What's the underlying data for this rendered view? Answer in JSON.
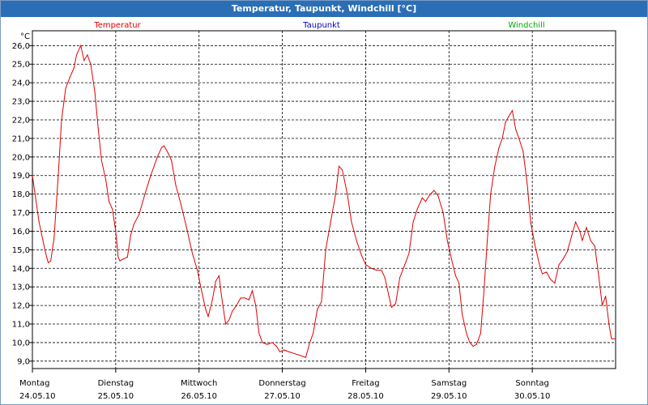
{
  "window": {
    "title": "Temperatur, Taupunkt, Windchill [°C]"
  },
  "chart_data": {
    "type": "line",
    "title": "Temperatur, Taupunkt, Windchill [°C]",
    "ylabel": "°C",
    "ylim": [
      8.6,
      26.8
    ],
    "yticks": [
      "26,0",
      "25,0",
      "24,0",
      "23,0",
      "22,0",
      "21,0",
      "20,0",
      "19,0",
      "18,0",
      "17,0",
      "16,0",
      "15,0",
      "14,0",
      "13,0",
      "12,0",
      "11,0",
      "10,0",
      "9,0"
    ],
    "xlim": [
      0,
      7
    ],
    "x_unit": "days since start of Montag 24.05.10",
    "days": [
      {
        "weekday": "Montag",
        "date": "24.05.10"
      },
      {
        "weekday": "Dienstag",
        "date": "25.05.10"
      },
      {
        "weekday": "Mittwoch",
        "date": "26.05.10"
      },
      {
        "weekday": "Donnerstag",
        "date": "27.05.10"
      },
      {
        "weekday": "Freitag",
        "date": "28.05.10"
      },
      {
        "weekday": "Samstag",
        "date": "29.05.10"
      },
      {
        "weekday": "Sonntag",
        "date": "30.05.10"
      }
    ],
    "legend_placement": "top",
    "grid": true,
    "series": [
      {
        "name": "Temperatur",
        "color": "#e00000",
        "points": [
          [
            0.0,
            19.0
          ],
          [
            0.08,
            16.5
          ],
          [
            0.15,
            15.0
          ],
          [
            0.19,
            14.3
          ],
          [
            0.22,
            14.4
          ],
          [
            0.26,
            15.6
          ],
          [
            0.31,
            19.0
          ],
          [
            0.35,
            22.0
          ],
          [
            0.4,
            23.7
          ],
          [
            0.45,
            24.3
          ],
          [
            0.5,
            24.8
          ],
          [
            0.53,
            25.5
          ],
          [
            0.58,
            26.0
          ],
          [
            0.62,
            25.2
          ],
          [
            0.66,
            25.5
          ],
          [
            0.7,
            25.0
          ],
          [
            0.75,
            23.5
          ],
          [
            0.79,
            21.5
          ],
          [
            0.83,
            19.8
          ],
          [
            0.88,
            18.8
          ],
          [
            0.92,
            17.6
          ],
          [
            0.96,
            17.2
          ],
          [
            1.0,
            16.0
          ],
          [
            1.03,
            14.6
          ],
          [
            1.05,
            14.4
          ],
          [
            1.09,
            14.5
          ],
          [
            1.14,
            14.6
          ],
          [
            1.18,
            15.8
          ],
          [
            1.22,
            16.4
          ],
          [
            1.28,
            16.9
          ],
          [
            1.35,
            18.0
          ],
          [
            1.42,
            19.0
          ],
          [
            1.5,
            20.0
          ],
          [
            1.55,
            20.5
          ],
          [
            1.58,
            20.6
          ],
          [
            1.63,
            20.2
          ],
          [
            1.67,
            19.8
          ],
          [
            1.72,
            18.5
          ],
          [
            1.78,
            17.5
          ],
          [
            1.85,
            16.2
          ],
          [
            1.92,
            14.8
          ],
          [
            1.98,
            13.9
          ],
          [
            2.03,
            12.8
          ],
          [
            2.08,
            11.8
          ],
          [
            2.11,
            11.4
          ],
          [
            2.16,
            12.3
          ],
          [
            2.2,
            13.3
          ],
          [
            2.24,
            13.6
          ],
          [
            2.27,
            12.5
          ],
          [
            2.32,
            11.0
          ],
          [
            2.36,
            11.2
          ],
          [
            2.4,
            11.7
          ],
          [
            2.45,
            12.0
          ],
          [
            2.5,
            12.4
          ],
          [
            2.55,
            12.4
          ],
          [
            2.6,
            12.3
          ],
          [
            2.64,
            12.8
          ],
          [
            2.68,
            12.0
          ],
          [
            2.72,
            10.5
          ],
          [
            2.76,
            10.0
          ],
          [
            2.82,
            9.9
          ],
          [
            2.88,
            10.0
          ],
          [
            2.93,
            9.8
          ],
          [
            2.97,
            9.5
          ],
          [
            3.02,
            9.6
          ],
          [
            3.08,
            9.5
          ],
          [
            3.15,
            9.4
          ],
          [
            3.22,
            9.3
          ],
          [
            3.28,
            9.2
          ],
          [
            3.33,
            10.0
          ],
          [
            3.37,
            10.5
          ],
          [
            3.42,
            11.8
          ],
          [
            3.47,
            12.2
          ],
          [
            3.52,
            15.0
          ],
          [
            3.58,
            16.5
          ],
          [
            3.64,
            18.0
          ],
          [
            3.68,
            19.5
          ],
          [
            3.72,
            19.3
          ],
          [
            3.78,
            18.0
          ],
          [
            3.83,
            16.5
          ],
          [
            3.89,
            15.5
          ],
          [
            3.95,
            14.7
          ],
          [
            4.0,
            14.2
          ],
          [
            4.07,
            14.0
          ],
          [
            4.13,
            13.9
          ],
          [
            4.19,
            13.9
          ],
          [
            4.23,
            13.5
          ],
          [
            4.28,
            12.5
          ],
          [
            4.31,
            11.9
          ],
          [
            4.36,
            12.1
          ],
          [
            4.41,
            13.5
          ],
          [
            4.47,
            14.2
          ],
          [
            4.52,
            14.8
          ],
          [
            4.57,
            16.5
          ],
          [
            4.62,
            17.2
          ],
          [
            4.68,
            17.8
          ],
          [
            4.72,
            17.6
          ],
          [
            4.76,
            17.9
          ],
          [
            4.82,
            18.2
          ],
          [
            4.87,
            17.9
          ],
          [
            4.93,
            17.0
          ],
          [
            4.98,
            15.5
          ],
          [
            5.03,
            14.5
          ],
          [
            5.08,
            13.6
          ],
          [
            5.12,
            13.2
          ],
          [
            5.16,
            11.5
          ],
          [
            5.21,
            10.5
          ],
          [
            5.25,
            10.0
          ],
          [
            5.29,
            9.8
          ],
          [
            5.33,
            9.9
          ],
          [
            5.38,
            10.5
          ],
          [
            5.42,
            12.8
          ],
          [
            5.46,
            15.5
          ],
          [
            5.5,
            18.0
          ],
          [
            5.55,
            19.5
          ],
          [
            5.6,
            20.5
          ],
          [
            5.64,
            21.0
          ],
          [
            5.68,
            21.9
          ],
          [
            5.72,
            22.2
          ],
          [
            5.76,
            22.5
          ],
          [
            5.8,
            21.5
          ],
          [
            5.84,
            21.0
          ],
          [
            5.89,
            20.3
          ],
          [
            5.94,
            18.5
          ],
          [
            5.98,
            16.5
          ],
          [
            6.03,
            15.3
          ],
          [
            6.08,
            14.3
          ],
          [
            6.12,
            13.7
          ],
          [
            6.17,
            13.8
          ],
          [
            6.22,
            13.4
          ],
          [
            6.27,
            13.2
          ],
          [
            6.32,
            14.2
          ],
          [
            6.37,
            14.5
          ],
          [
            6.42,
            14.9
          ],
          [
            6.47,
            15.7
          ],
          [
            6.52,
            16.5
          ],
          [
            6.57,
            16.0
          ],
          [
            6.6,
            15.5
          ],
          [
            6.65,
            16.2
          ],
          [
            6.7,
            15.5
          ],
          [
            6.75,
            15.2
          ],
          [
            6.8,
            13.5
          ],
          [
            6.84,
            12.0
          ],
          [
            6.88,
            12.5
          ],
          [
            6.92,
            11.0
          ],
          [
            6.95,
            10.2
          ],
          [
            7.0,
            10.2
          ]
        ]
      },
      {
        "name": "Taupunkt",
        "color": "#0000cc",
        "points": []
      },
      {
        "name": "Windchill",
        "color": "#00aa00",
        "points": []
      }
    ]
  }
}
